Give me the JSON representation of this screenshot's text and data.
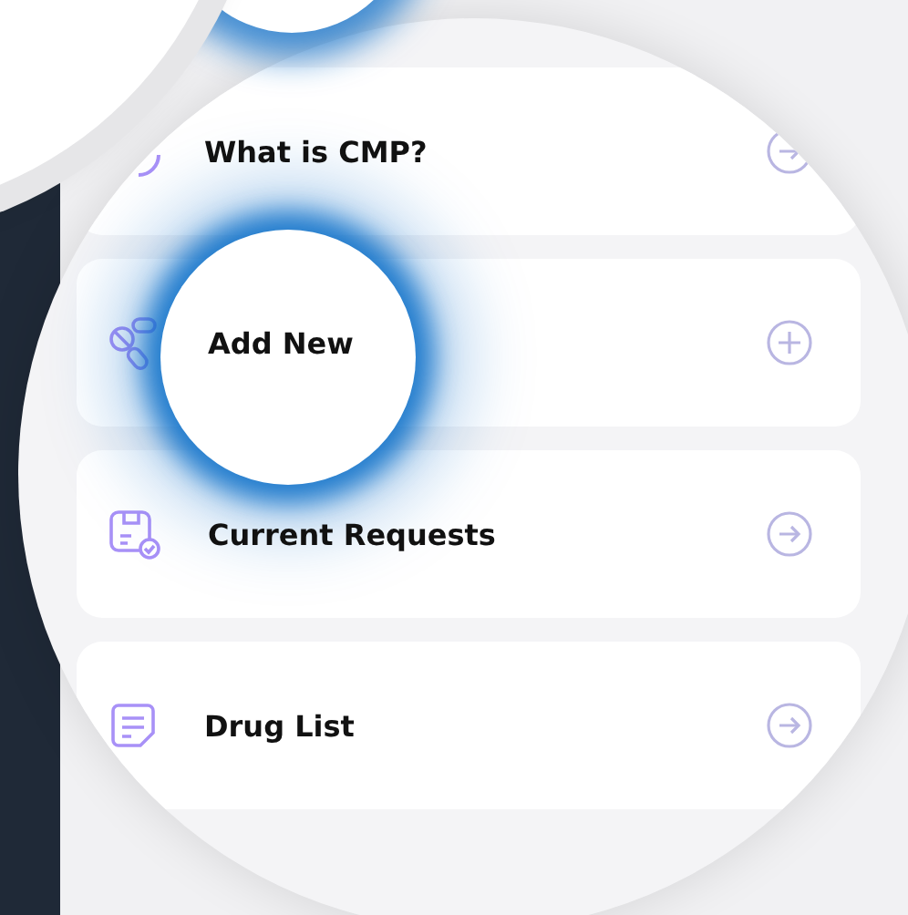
{
  "menu": [
    {
      "kind": "help",
      "label": "What is CMP?",
      "highlighted": false
    },
    {
      "kind": "add",
      "label": "Add New",
      "highlighted": true
    },
    {
      "kind": "requests",
      "label": "Current Requests",
      "highlighted": false
    },
    {
      "kind": "list",
      "label": "Drug List",
      "highlighted": false
    }
  ]
}
